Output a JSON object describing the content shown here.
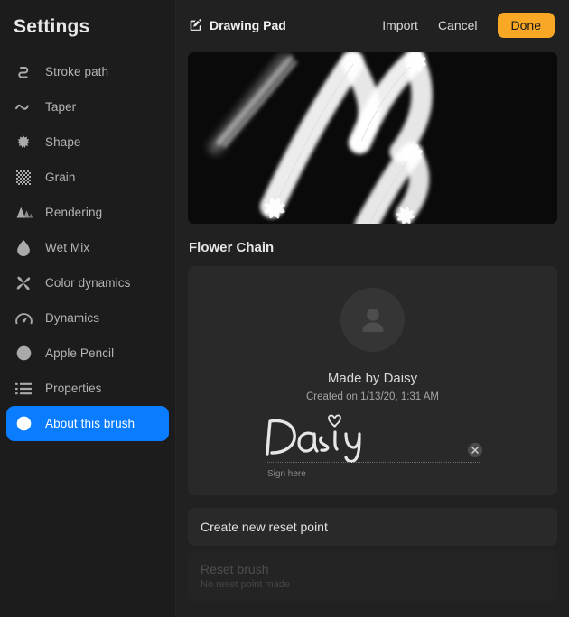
{
  "sidebar": {
    "title": "Settings",
    "items": [
      {
        "label": "Stroke path",
        "icon": "stroke-path-icon",
        "active": false
      },
      {
        "label": "Taper",
        "icon": "taper-icon",
        "active": false
      },
      {
        "label": "Shape",
        "icon": "shape-icon",
        "active": false
      },
      {
        "label": "Grain",
        "icon": "grain-icon",
        "active": false
      },
      {
        "label": "Rendering",
        "icon": "rendering-icon",
        "active": false
      },
      {
        "label": "Wet Mix",
        "icon": "wet-mix-icon",
        "active": false
      },
      {
        "label": "Color dynamics",
        "icon": "color-dynamics-icon",
        "active": false
      },
      {
        "label": "Dynamics",
        "icon": "dynamics-icon",
        "active": false
      },
      {
        "label": "Apple Pencil",
        "icon": "apple-pencil-icon",
        "active": false
      },
      {
        "label": "Properties",
        "icon": "properties-icon",
        "active": false
      },
      {
        "label": "About this brush",
        "icon": "info-icon",
        "active": true
      }
    ],
    "active_color": "#0a7cff"
  },
  "topbar": {
    "pad_title": "Drawing Pad",
    "import_label": "Import",
    "cancel_label": "Cancel",
    "done_label": "Done",
    "done_color": "#f9a825"
  },
  "main": {
    "brush_name": "Flower Chain",
    "author": {
      "made_by": "Made by Daisy",
      "created_on": "Created on 1/13/20, 1:31 AM",
      "signature_text": "Daisy",
      "sign_hint": "Sign here"
    },
    "create_reset_point_label": "Create new reset point",
    "reset_brush_label": "Reset brush",
    "reset_brush_sub": "No reset point made"
  }
}
